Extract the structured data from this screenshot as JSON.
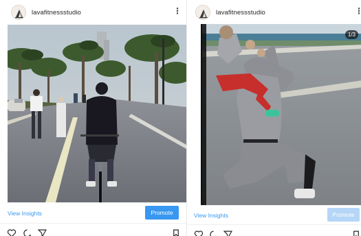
{
  "posts": [
    {
      "username": "lavafitnessstudio",
      "more_icon": "more-vertical-icon",
      "insights_label": "View Insights",
      "promote_label": "Promote",
      "promote_color": "#3897f0",
      "icons": [
        "heart-icon",
        "comment-icon",
        "send-icon",
        "bookmark-icon"
      ]
    },
    {
      "username": "lavafitnessstudio",
      "more_icon": "more-vertical-icon",
      "carousel_counter": "1/3",
      "insights_label": "View Insights",
      "promote_label": "Promote",
      "promote_color": "#b5d6f6",
      "icons": [
        "heart-icon",
        "comment-icon",
        "send-icon",
        "bookmark-icon"
      ]
    }
  ],
  "more_glyph": "⋮"
}
